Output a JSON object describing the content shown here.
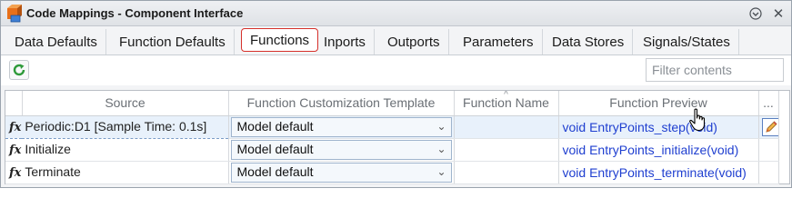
{
  "window": {
    "title": "Code Mappings - Component Interface"
  },
  "tabs": [
    {
      "label": "Data Defaults"
    },
    {
      "label": "Function Defaults"
    },
    {
      "label": "Functions",
      "active": true
    },
    {
      "label": "Inports"
    },
    {
      "label": "Outports"
    },
    {
      "label": "Parameters"
    },
    {
      "label": "Data Stores"
    },
    {
      "label": "Signals/States"
    }
  ],
  "toolbar": {
    "filter_placeholder": "Filter contents"
  },
  "table": {
    "columns": [
      "Source",
      "Function Customization Template",
      "Function Name",
      "Function Preview",
      "..."
    ],
    "rows": [
      {
        "source": "Periodic:D1 [Sample Time: 0.1s]",
        "template": "Model default",
        "function_name": "",
        "preview": "void EntryPoints_step(void)",
        "selected": true
      },
      {
        "source": "Initialize",
        "template": "Model default",
        "function_name": "",
        "preview": "void EntryPoints_initialize(void)",
        "selected": false
      },
      {
        "source": "Terminate",
        "template": "Model default",
        "function_name": "",
        "preview": "void EntryPoints_terminate(void)",
        "selected": false
      }
    ]
  },
  "colors": {
    "active_tab_border": "#d6312b",
    "link": "#1f3fd0",
    "selection": "#e8f1fb"
  },
  "icons": {
    "app": "simulink-icon",
    "refresh": "refresh-icon",
    "menu": "panel-menu-icon",
    "close": "close-icon",
    "function": "fx-icon",
    "edit": "pencil-icon",
    "cursor": "hand-pointer-icon"
  }
}
